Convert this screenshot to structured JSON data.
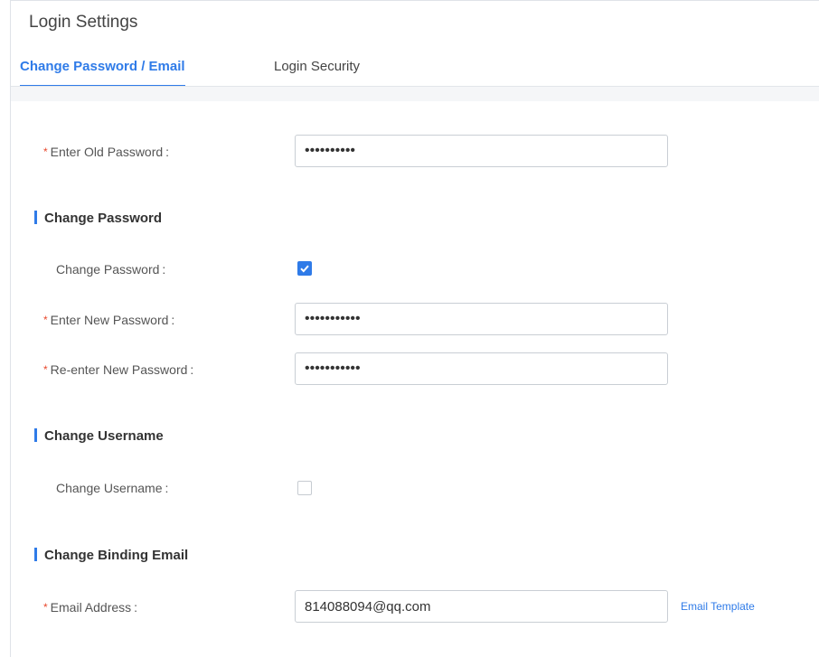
{
  "page_title": "Login Settings",
  "tabs": [
    {
      "label": "Change Password / Email",
      "active": true
    },
    {
      "label": "Login Security",
      "active": false
    }
  ],
  "old_password": {
    "label": "Enter Old Password",
    "value": "••••••••••"
  },
  "change_password_section": {
    "title": "Change Password",
    "toggle_label": "Change Password",
    "toggle_checked": true,
    "new_password": {
      "label": "Enter New Password",
      "value": "•••••••••••"
    },
    "reenter_password": {
      "label": "Re-enter New Password",
      "value": "•••••••••••"
    }
  },
  "change_username_section": {
    "title": "Change Username",
    "toggle_label": "Change Username",
    "toggle_checked": false
  },
  "change_email_section": {
    "title": "Change Binding Email",
    "email": {
      "label": "Email Address",
      "value": "814088094@qq.com"
    },
    "template_link": "Email Template"
  },
  "colon": ":",
  "required_mark": "*",
  "colors": {
    "accent": "#2f7be8",
    "required": "#e8472c",
    "border": "#c9ced4"
  },
  "icons": {
    "checkbox_checked": "check-icon"
  }
}
